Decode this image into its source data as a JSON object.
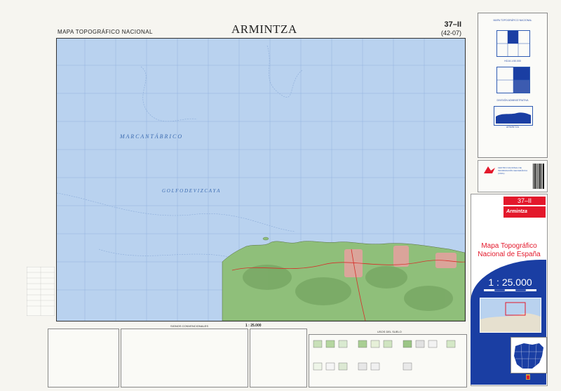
{
  "header": {
    "series_title": "MAPA TOPOGRÁFICO NACIONAL",
    "sheet_name": "ARMINTZA",
    "sheet_code": "37–II",
    "sheet_code_alt": "(42-07)"
  },
  "map": {
    "sea_label_1": "M A R   C A N T Á B R I C O",
    "sea_label_2": "G O L F O   D E   V I Z C A Y A"
  },
  "legend": {
    "scale_label": "1 : 25.000",
    "signos_title": "SIGNOS CONVENCIONALES",
    "usos_title": "USOS DEL SUELO"
  },
  "right_panel": {
    "title_line1": "MAPA TOPOGRÁFICO NACIONAL",
    "sheet_name": "ARMINTZA",
    "block2": "HOJA 1:50.000",
    "block3": "DIVISIÓN ADMINISTRATIVA"
  },
  "cnig": {
    "name": "CENTRO NACIONAL DE INFORMACIÓN GEOGRÁFICA (CNIG)"
  },
  "cover": {
    "sheet_code": "37–II",
    "sheet_name": "Armintza",
    "title": "Mapa Topográfico Nacional de España",
    "scale": "1 : 25.000"
  },
  "colors": {
    "sea": "#b9d2ef",
    "land": "#8fbf7a",
    "urban": "#e8a0a0",
    "accent_red": "#e3182b",
    "accent_blue": "#1a3ea3"
  }
}
